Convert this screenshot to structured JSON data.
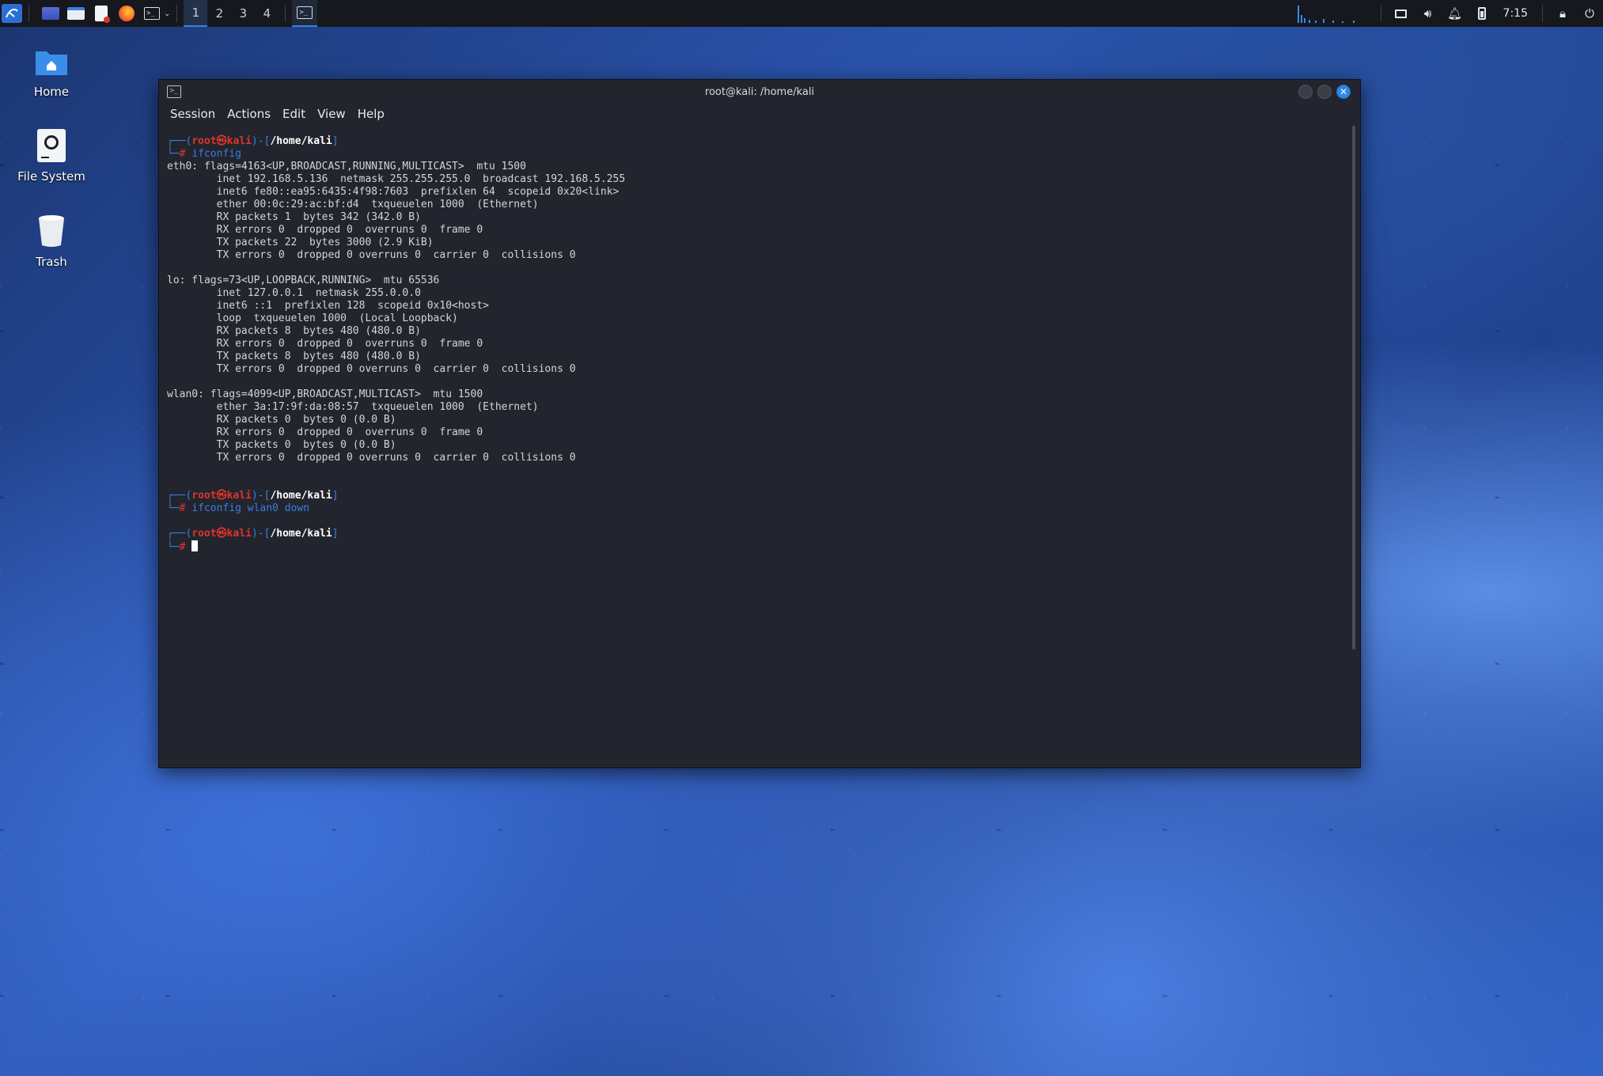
{
  "taskbar": {
    "workspaces": [
      "1",
      "2",
      "3",
      "4"
    ],
    "clock": "7:15"
  },
  "desktop": {
    "icons": [
      {
        "label": "Home"
      },
      {
        "label": "File System"
      },
      {
        "label": "Trash"
      }
    ]
  },
  "window": {
    "title": "root@kali: /home/kali",
    "menu": [
      "Session",
      "Actions",
      "Edit",
      "View",
      "Help"
    ]
  },
  "terminal": {
    "prompt": {
      "user": "root",
      "host": "kali",
      "dir": "/home/kali",
      "symbol": "#"
    },
    "commands": [
      "ifconfig",
      "ifconfig wlan0 down"
    ],
    "output": [
      "eth0: flags=4163<UP,BROADCAST,RUNNING,MULTICAST>  mtu 1500",
      "        inet 192.168.5.136  netmask 255.255.255.0  broadcast 192.168.5.255",
      "        inet6 fe80::ea95:6435:4f98:7603  prefixlen 64  scopeid 0x20<link>",
      "        ether 00:0c:29:ac:bf:d4  txqueuelen 1000  (Ethernet)",
      "        RX packets 1  bytes 342 (342.0 B)",
      "        RX errors 0  dropped 0  overruns 0  frame 0",
      "        TX packets 22  bytes 3000 (2.9 KiB)",
      "        TX errors 0  dropped 0 overruns 0  carrier 0  collisions 0",
      "",
      "lo: flags=73<UP,LOOPBACK,RUNNING>  mtu 65536",
      "        inet 127.0.0.1  netmask 255.0.0.0",
      "        inet6 ::1  prefixlen 128  scopeid 0x10<host>",
      "        loop  txqueuelen 1000  (Local Loopback)",
      "        RX packets 8  bytes 480 (480.0 B)",
      "        RX errors 0  dropped 0  overruns 0  frame 0",
      "        TX packets 8  bytes 480 (480.0 B)",
      "        TX errors 0  dropped 0 overruns 0  carrier 0  collisions 0",
      "",
      "wlan0: flags=4099<UP,BROADCAST,MULTICAST>  mtu 1500",
      "        ether 3a:17:9f:da:08:57  txqueuelen 1000  (Ethernet)",
      "        RX packets 0  bytes 0 (0.0 B)",
      "        RX errors 0  dropped 0  overruns 0  frame 0",
      "        TX packets 0  bytes 0 (0.0 B)",
      "        TX errors 0  dropped 0 overruns 0  carrier 0  collisions 0"
    ]
  },
  "colors": {
    "accent": "#3b7de3",
    "prompt_red": "#e0342b",
    "terminal_bg": "#22252d",
    "taskbar_bg": "#16181d"
  },
  "icons": [
    "kali-menu-icon",
    "desktop-icon",
    "file-manager-icon",
    "text-editor-icon",
    "firefox-icon",
    "terminal-icon",
    "home-folder-icon",
    "drive-icon",
    "trash-icon",
    "display-icon",
    "volume-icon",
    "bell-icon",
    "battery-icon",
    "lock-icon",
    "power-icon"
  ]
}
